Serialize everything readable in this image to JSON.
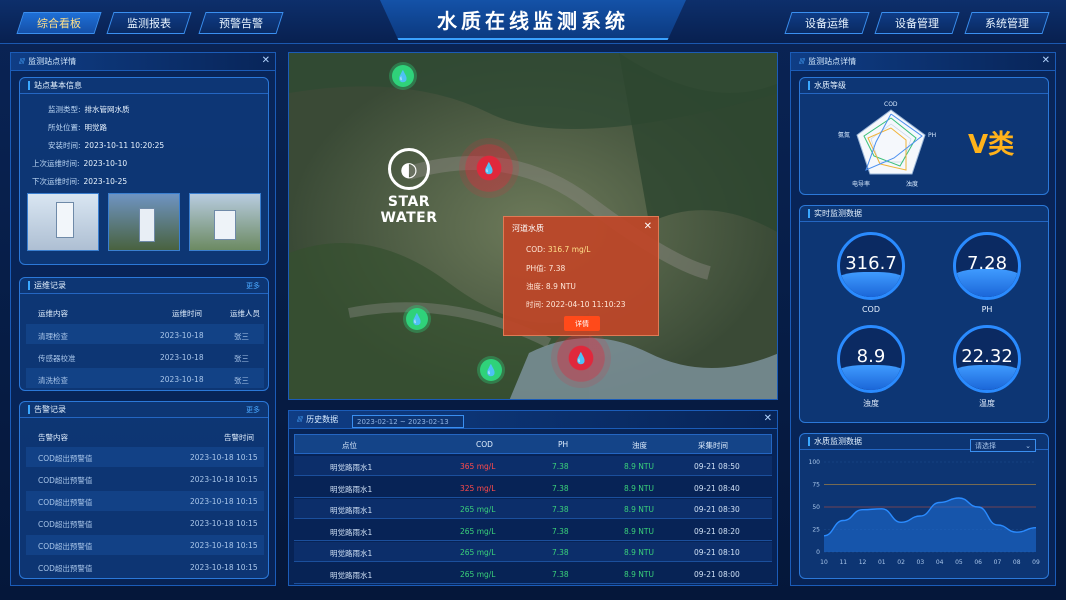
{
  "nav": {
    "left": [
      "综合看板",
      "监测报表",
      "预警告警"
    ],
    "right": [
      "设备运维",
      "设备管理",
      "系统管理"
    ],
    "title": "水质在线监测系统"
  },
  "left_panel": {
    "title": "监测站点详情",
    "basic": {
      "title": "站点基本信息",
      "rows": [
        {
          "label": "监测类型:",
          "value": "排水管网水质"
        },
        {
          "label": "所处位置:",
          "value": "明觉路"
        },
        {
          "label": "安装时间:",
          "value": "2023-10-11 10:20:25"
        },
        {
          "label": "上次运维时间:",
          "value": "2023-10-10"
        },
        {
          "label": "下次运维时间:",
          "value": "2023-10-25"
        }
      ]
    },
    "maint": {
      "title": "运维记录",
      "more": "更多",
      "headers": [
        "运维内容",
        "运维时间",
        "运维人员"
      ],
      "rows": [
        [
          "清理检查",
          "2023-10-18",
          "张三"
        ],
        [
          "传感器校准",
          "2023-10-18",
          "张三"
        ],
        [
          "清洗检查",
          "2023-10-18",
          "张三"
        ]
      ]
    },
    "alarm": {
      "title": "告警记录",
      "more": "更多",
      "headers": [
        "告警内容",
        "告警时间"
      ],
      "rows": [
        [
          "COD超出预警值",
          "2023-10-18 10:15"
        ],
        [
          "COD超出预警值",
          "2023-10-18 10:15"
        ],
        [
          "COD超出预警值",
          "2023-10-18 10:15"
        ],
        [
          "COD超出预警值",
          "2023-10-18 10:15"
        ],
        [
          "COD超出预警值",
          "2023-10-18 10:15"
        ],
        [
          "COD超出预警值",
          "2023-10-18 10:15"
        ]
      ]
    }
  },
  "map": {
    "logo": "STAR WATER",
    "popup": {
      "title": "河道水质",
      "rows": [
        {
          "label": "COD:",
          "value": "316.7 mg/L",
          "highlight": true
        },
        {
          "label": "PH值:",
          "value": "7.38",
          "highlight": false
        },
        {
          "label": "浊度:",
          "value": "8.9 NTU",
          "highlight": false
        },
        {
          "label": "时间:",
          "value": "2022-04-10 11:10:23",
          "highlight": false
        }
      ],
      "button": "详情"
    }
  },
  "history": {
    "title": "历史数据",
    "date_range": "2023-02-12 ~ 2023-02-13",
    "headers": [
      "点位",
      "COD",
      "PH",
      "浊度",
      "采集时间"
    ],
    "rows": [
      {
        "site": "明觉路雨水1",
        "cod": "365 mg/L",
        "ph": "7.38",
        "turb": "8.9 NTU",
        "time": "09-21 08:50",
        "alert": true
      },
      {
        "site": "明觉路雨水1",
        "cod": "325 mg/L",
        "ph": "7.38",
        "turb": "8.9 NTU",
        "time": "09-21 08:40",
        "alert": true
      },
      {
        "site": "明觉路雨水1",
        "cod": "265 mg/L",
        "ph": "7.38",
        "turb": "8.9 NTU",
        "time": "09-21 08:30",
        "alert": false
      },
      {
        "site": "明觉路雨水1",
        "cod": "265 mg/L",
        "ph": "7.38",
        "turb": "8.9 NTU",
        "time": "09-21 08:20",
        "alert": false
      },
      {
        "site": "明觉路雨水1",
        "cod": "265 mg/L",
        "ph": "7.38",
        "turb": "8.9 NTU",
        "time": "09-21 08:10",
        "alert": false
      },
      {
        "site": "明觉路雨水1",
        "cod": "265 mg/L",
        "ph": "7.38",
        "turb": "8.9 NTU",
        "time": "09-21 08:00",
        "alert": false
      }
    ]
  },
  "right_panel": {
    "title": "监测站点详情",
    "grade_title": "水质等级",
    "grade": "V类",
    "radar_axes": [
      "COD",
      "PH",
      "浊度",
      "电导率",
      "氨氮"
    ],
    "realtime": {
      "title": "实时监测数据",
      "gauges": [
        {
          "value": "316.7",
          "label": "COD",
          "level": 0.4
        },
        {
          "value": "7.28",
          "label": "PH",
          "level": 0.45
        },
        {
          "value": "8.9",
          "label": "浊度",
          "level": 0.4
        },
        {
          "value": "22.32",
          "label": "温度",
          "level": 0.4
        }
      ]
    },
    "chart_title": "水质监测数据",
    "select": "请选择"
  },
  "chart_data": {
    "type": "area",
    "title": "水质监测数据",
    "categories": [
      "10",
      "11",
      "12",
      "01",
      "02",
      "03",
      "04",
      "05",
      "06",
      "07",
      "08",
      "09"
    ],
    "values": [
      18,
      35,
      47,
      48,
      33,
      40,
      55,
      60,
      50,
      30,
      22,
      27
    ],
    "yticks": [
      0,
      25,
      50,
      75,
      100
    ],
    "ylim": [
      0,
      100
    ],
    "reference_lines": [
      75,
      50
    ],
    "color": "#2a8bff"
  }
}
